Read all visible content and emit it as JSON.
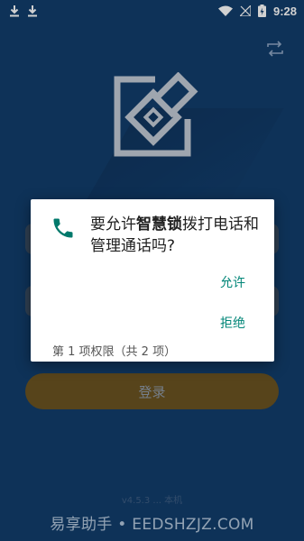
{
  "status_bar": {
    "time": "9:28",
    "icons": [
      "download-icon",
      "download-icon",
      "wifi-icon",
      "no-signal-icon",
      "battery-charging-icon"
    ]
  },
  "header": {
    "switch_icon": "swap-icon"
  },
  "logo": {
    "icon": "app-logo-icon"
  },
  "login": {
    "button_label": "登录"
  },
  "version": {
    "text": "v4.5.3 ... 本机"
  },
  "watermark": {
    "text": "易享助手 • EEDSHZJZ.COM"
  },
  "dialog": {
    "icon": "phone-icon",
    "message_prefix": "要允许",
    "app_name": "智慧锁",
    "message_suffix": "拨打电话和管理通话吗?",
    "allow_label": "允许",
    "deny_label": "拒绝",
    "counter": "第 1 项权限（共 2 项）"
  },
  "colors": {
    "background": "#123d6c",
    "login_button": "#6b5321",
    "dialog_accent": "#008577",
    "phone_icon": "#00796b"
  }
}
